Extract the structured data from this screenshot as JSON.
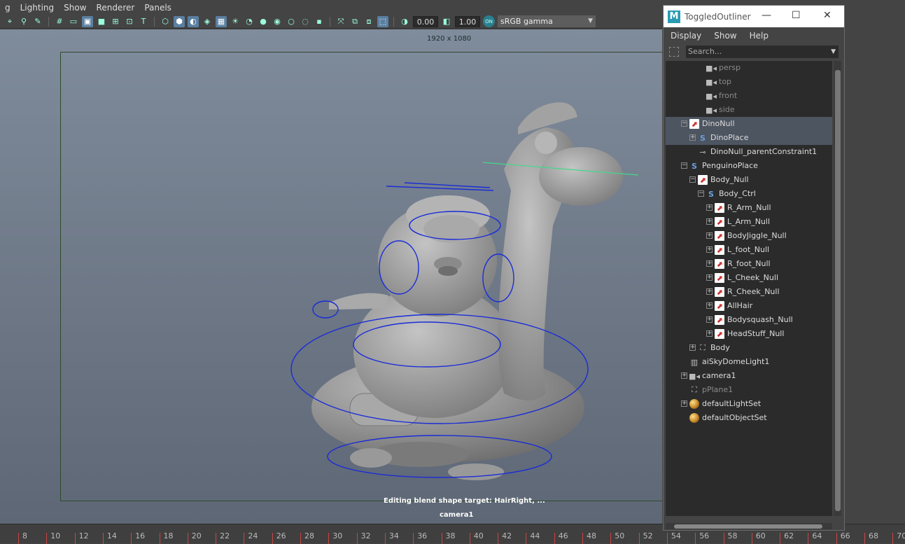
{
  "menubar": {
    "items": [
      "g",
      "Lighting",
      "Show",
      "Renderer",
      "Panels"
    ]
  },
  "toolbar": {
    "exposure": "0.00",
    "gamma": "1.00",
    "color_management_badge": "ON",
    "color_space": "sRGB gamma"
  },
  "viewport": {
    "resolution_label": "1920 x 1080",
    "hud_message": "Editing blend shape target: HairRight, ...",
    "camera_label": "camera1"
  },
  "timeline": {
    "ticks": [
      "8",
      "10",
      "12",
      "14",
      "16",
      "18",
      "20",
      "22",
      "24",
      "26",
      "28",
      "30",
      "32",
      "34",
      "36",
      "38",
      "40",
      "42",
      "44",
      "46",
      "48",
      "50",
      "52",
      "54",
      "56",
      "58",
      "60",
      "62",
      "64",
      "66",
      "68",
      "70"
    ]
  },
  "outliner": {
    "title": "ToggledOutliner",
    "menu": [
      "Display",
      "Show",
      "Help"
    ],
    "search_placeholder": "Search...",
    "items": [
      {
        "label": "persp",
        "icon": "camera-icon",
        "dim": true
      },
      {
        "label": "top",
        "icon": "camera-icon",
        "dim": true
      },
      {
        "label": "front",
        "icon": "camera-icon",
        "dim": true
      },
      {
        "label": "side",
        "icon": "camera-icon",
        "dim": true
      },
      {
        "label": "DinoNull",
        "icon": "null-icon",
        "selected": true,
        "expanded": true
      },
      {
        "label": "DinoPlace",
        "icon": "curve-icon",
        "selected": true,
        "collapsed": true
      },
      {
        "label": "DinoNull_parentConstraint1",
        "icon": "constraint-icon"
      },
      {
        "label": "PenguinoPlace",
        "icon": "curve-icon",
        "expanded": true
      },
      {
        "label": "Body_Null",
        "icon": "null-icon",
        "expanded": true
      },
      {
        "label": "Body_Ctrl",
        "icon": "curve-icon",
        "expanded": true
      },
      {
        "label": "R_Arm_Null",
        "icon": "null-icon",
        "collapsed": true
      },
      {
        "label": "L_Arm_Null",
        "icon": "null-icon",
        "collapsed": true
      },
      {
        "label": "BodyJiggle_Null",
        "icon": "null-icon",
        "collapsed": true
      },
      {
        "label": "L_foot_Null",
        "icon": "null-icon",
        "collapsed": true
      },
      {
        "label": "R_foot_Null",
        "icon": "null-icon",
        "collapsed": true
      },
      {
        "label": "L_Cheek_Null",
        "icon": "null-icon",
        "collapsed": true
      },
      {
        "label": "R_Cheek_Null",
        "icon": "null-icon",
        "collapsed": true
      },
      {
        "label": "AllHair",
        "icon": "null-icon",
        "collapsed": true
      },
      {
        "label": "Bodysquash_Null",
        "icon": "null-icon",
        "collapsed": true
      },
      {
        "label": "HeadStuff_Null",
        "icon": "null-icon",
        "collapsed": true
      },
      {
        "label": "Body",
        "icon": "mesh-icon",
        "collapsed": true
      },
      {
        "label": "aiSkyDomeLight1",
        "icon": "light-icon"
      },
      {
        "label": "camera1",
        "icon": "camera-icon",
        "collapsed": true
      },
      {
        "label": "pPlane1",
        "icon": "mesh-icon",
        "dim": true
      },
      {
        "label": "defaultLightSet",
        "icon": "set-icon",
        "collapsed": true
      },
      {
        "label": "defaultObjectSet",
        "icon": "set-icon"
      }
    ]
  }
}
